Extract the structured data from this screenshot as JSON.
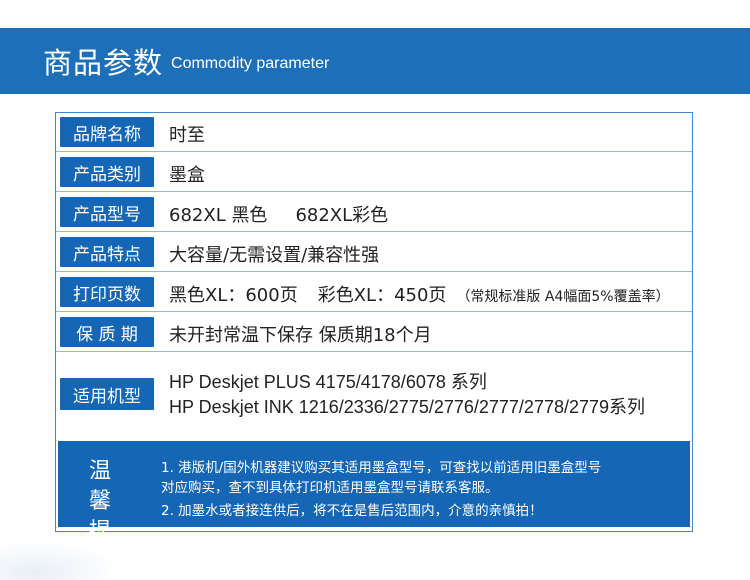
{
  "header": {
    "title_cn": "商品参数",
    "title_en": "Commodity parameter"
  },
  "rows": [
    {
      "label": "品牌名称",
      "value": "时至"
    },
    {
      "label": "产品类别",
      "value": "墨盒"
    },
    {
      "label": "产品型号",
      "value_a": "682XL 黑色",
      "value_b": "682XL彩色"
    },
    {
      "label": "产品特点",
      "value": "大容量/无需设置/兼容性强"
    },
    {
      "label": "打印页数",
      "value_a": "黑色XL：600页",
      "value_b": "彩色XL：450页",
      "note": "（常规标准版 A4幅面5%覆盖率）"
    },
    {
      "label": "保 质 期",
      "value": "未开封常温下保存  保质期18个月"
    },
    {
      "label": "适用机型",
      "line1": "HP Deskjet PLUS  4175/4178/6078 系列",
      "line2": "HP Deskjet INK  1216/2336/2775/2776/2777/2778/2779系列"
    }
  ],
  "notice": {
    "label": "温 馨 提 示",
    "line1": "1. 港版机/国外机器建议购买其适用墨盒型号，可查找以前适用旧墨盒型号",
    "line2": "对应购买，查不到具体打印机适用墨盒型号请联系客服。",
    "line3": "2. 加墨水或者接连供后，将不在是售后范围内，介意的亲慎拍！"
  },
  "colors": {
    "banner": "#1d6fb8",
    "label_bg": "#1566b5",
    "border": "#4a87c6"
  }
}
